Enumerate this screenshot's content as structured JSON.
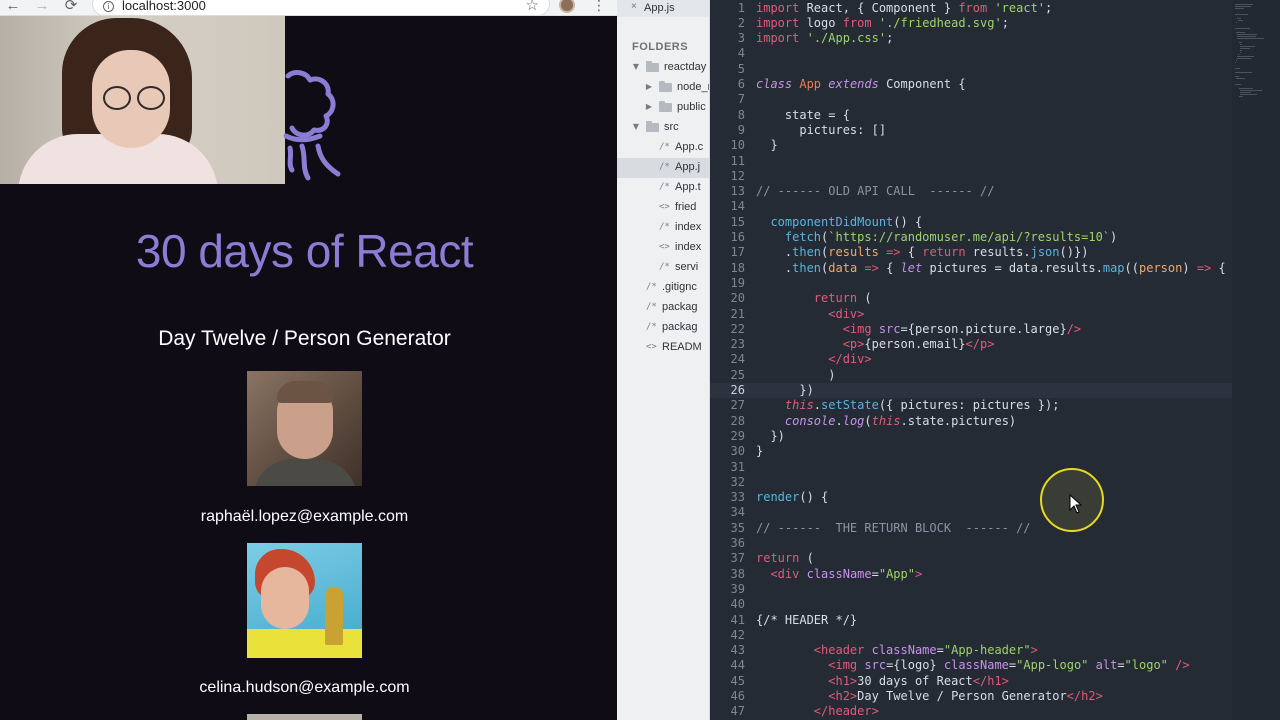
{
  "browser": {
    "url": "localhost:3000",
    "nav": {
      "back": "←",
      "forward": "→",
      "reload": "⟳"
    },
    "star": "☆",
    "info": "i",
    "menu": "⋮"
  },
  "app": {
    "title": "30 days of React",
    "subtitle": "Day Twelve / Person Generator",
    "people": [
      {
        "email": "raphaël.lopez@example.com"
      },
      {
        "email": "celina.hudson@example.com"
      }
    ]
  },
  "editor": {
    "tab": {
      "label": "App.js",
      "close": "×"
    },
    "folders_heading": "FOLDERS",
    "tree": [
      {
        "label": "reactday",
        "arrow": "▼",
        "kind": "folder"
      },
      {
        "label": "node_m",
        "arrow": "▶",
        "kind": "folder"
      },
      {
        "label": "public",
        "arrow": "▶",
        "kind": "folder"
      },
      {
        "label": "src",
        "arrow": "▼",
        "kind": "folder"
      },
      {
        "label": "App.c",
        "icon": "/*",
        "kind": "file"
      },
      {
        "label": "App.j",
        "icon": "/*",
        "kind": "file",
        "selected": true
      },
      {
        "label": "App.t",
        "icon": "/*",
        "kind": "file"
      },
      {
        "label": "fried",
        "icon": "<>",
        "kind": "file"
      },
      {
        "label": "index",
        "icon": "/*",
        "kind": "file"
      },
      {
        "label": "index",
        "icon": "<>",
        "kind": "file"
      },
      {
        "label": "servi",
        "icon": "/*",
        "kind": "file"
      },
      {
        "label": ".gitignc",
        "icon": "/*",
        "kind": "file"
      },
      {
        "label": "packag",
        "icon": "/*",
        "kind": "file"
      },
      {
        "label": "packag",
        "icon": "/*",
        "kind": "file"
      },
      {
        "label": "READM",
        "icon": "<>",
        "kind": "file"
      }
    ],
    "current_line": 26,
    "code": [
      [
        [
          "k",
          "import"
        ],
        [
          "pn",
          " React, { Component } "
        ],
        [
          "k",
          "from"
        ],
        [
          "pn",
          " "
        ],
        [
          "s",
          "'react'"
        ],
        [
          "pn",
          ";"
        ]
      ],
      [
        [
          "k",
          "import"
        ],
        [
          "pn",
          " logo "
        ],
        [
          "k",
          "from"
        ],
        [
          "pn",
          " "
        ],
        [
          "s",
          "'./friedhead.svg'"
        ],
        [
          "pn",
          ";"
        ]
      ],
      [
        [
          "k",
          "import"
        ],
        [
          "pn",
          " "
        ],
        [
          "s",
          "'./App.css'"
        ],
        [
          "pn",
          ";"
        ]
      ],
      [],
      [],
      [
        [
          "it",
          "class"
        ],
        [
          "pn",
          " "
        ],
        [
          "cls",
          "App"
        ],
        [
          "pn",
          " "
        ],
        [
          "it",
          "extends"
        ],
        [
          "pn",
          " Component {"
        ]
      ],
      [],
      [
        [
          "pn",
          "    state = {"
        ]
      ],
      [
        [
          "pn",
          "      pictures: []"
        ]
      ],
      [
        [
          "pn",
          "  }"
        ]
      ],
      [],
      [],
      [
        [
          "c",
          "// ------ OLD API CALL  ------ //"
        ]
      ],
      [],
      [
        [
          "f",
          "  componentDidMount"
        ],
        [
          "pn",
          "() {"
        ]
      ],
      [
        [
          "f",
          "    fetch"
        ],
        [
          "pn",
          "("
        ],
        [
          "s",
          "`https://randomuser.me/api/?results=10`"
        ],
        [
          "pn",
          ")"
        ]
      ],
      [
        [
          "pn",
          "    ."
        ],
        [
          "f",
          "then"
        ],
        [
          "pn",
          "("
        ],
        [
          "pm",
          "results"
        ],
        [
          "pn",
          " "
        ],
        [
          "k",
          "=>"
        ],
        [
          "pn",
          " { "
        ],
        [
          "k",
          "return"
        ],
        [
          "pn",
          " results."
        ],
        [
          "f",
          "json"
        ],
        [
          "pn",
          "()})"
        ]
      ],
      [
        [
          "pn",
          "    ."
        ],
        [
          "f",
          "then"
        ],
        [
          "pn",
          "("
        ],
        [
          "pm",
          "data"
        ],
        [
          "pn",
          " "
        ],
        [
          "k",
          "=>"
        ],
        [
          "pn",
          " { "
        ],
        [
          "it",
          "let"
        ],
        [
          "pn",
          " pictures = data.results."
        ],
        [
          "f",
          "map"
        ],
        [
          "pn",
          "(("
        ],
        [
          "pm",
          "person"
        ],
        [
          "pn",
          ") "
        ],
        [
          "k",
          "=>"
        ],
        [
          "pn",
          " {"
        ]
      ],
      [],
      [
        [
          "k",
          "        return"
        ],
        [
          "pn",
          " ("
        ]
      ],
      [
        [
          "tg",
          "          <div"
        ],
        [
          "tg",
          ">"
        ]
      ],
      [
        [
          "tg",
          "            <img"
        ],
        [
          "pn",
          " "
        ],
        [
          "at",
          "src"
        ],
        [
          "pn",
          "={person.picture.large}"
        ],
        [
          "tg",
          "/>"
        ]
      ],
      [
        [
          "tg",
          "            <p"
        ],
        [
          "tg",
          ">"
        ],
        [
          "pn",
          "{person.email}"
        ],
        [
          "tg",
          "</p>"
        ]
      ],
      [
        [
          "tg",
          "          </div>"
        ]
      ],
      [
        [
          "pn",
          "          )"
        ]
      ],
      [
        [
          "pn",
          "      })"
        ]
      ],
      [
        [
          "th",
          "    this"
        ],
        [
          "pn",
          "."
        ],
        [
          "f",
          "setState"
        ],
        [
          "pn",
          "({ pictures: pictures });"
        ]
      ],
      [
        [
          "it",
          "    console"
        ],
        [
          "pn",
          "."
        ],
        [
          "it",
          "log"
        ],
        [
          "pn",
          "("
        ],
        [
          "th",
          "this"
        ],
        [
          "pn",
          ".state.pictures)"
        ]
      ],
      [
        [
          "pn",
          "  })"
        ]
      ],
      [
        [
          "pn",
          "}"
        ]
      ],
      [],
      [],
      [
        [
          "f",
          "render"
        ],
        [
          "pn",
          "() {"
        ]
      ],
      [],
      [
        [
          "c",
          "// ------  THE RETURN BLOCK  ------ //"
        ]
      ],
      [],
      [
        [
          "k",
          "return"
        ],
        [
          "pn",
          " ("
        ]
      ],
      [
        [
          "tg",
          "  <div"
        ],
        [
          "pn",
          " "
        ],
        [
          "at",
          "className"
        ],
        [
          "pn",
          "="
        ],
        [
          "s",
          "\"App\""
        ],
        [
          "tg",
          ">"
        ]
      ],
      [],
      [],
      [
        [
          "pn",
          "{/* HEADER */}"
        ]
      ],
      [],
      [
        [
          "tg",
          "        <header"
        ],
        [
          "pn",
          " "
        ],
        [
          "at",
          "className"
        ],
        [
          "pn",
          "="
        ],
        [
          "s",
          "\"App-header\""
        ],
        [
          "tg",
          ">"
        ]
      ],
      [
        [
          "tg",
          "          <img"
        ],
        [
          "pn",
          " "
        ],
        [
          "at",
          "src"
        ],
        [
          "pn",
          "={logo} "
        ],
        [
          "at",
          "className"
        ],
        [
          "pn",
          "="
        ],
        [
          "s",
          "\"App-logo\""
        ],
        [
          "pn",
          " "
        ],
        [
          "at",
          "alt"
        ],
        [
          "pn",
          "="
        ],
        [
          "s",
          "\"logo\""
        ],
        [
          "pn",
          " "
        ],
        [
          "tg",
          "/>"
        ]
      ],
      [
        [
          "tg",
          "          <h1"
        ],
        [
          "tg",
          ">"
        ],
        [
          "pn",
          "30 days of React"
        ],
        [
          "tg",
          "</h1>"
        ]
      ],
      [
        [
          "tg",
          "          <h2"
        ],
        [
          "tg",
          ">"
        ],
        [
          "pn",
          "Day Twelve / Person Generator"
        ],
        [
          "tg",
          "</h2>"
        ]
      ],
      [
        [
          "tg",
          "        </header>"
        ]
      ]
    ]
  },
  "colors": {
    "accent_title": "#8b7dd3",
    "editor_bg": "#252b35",
    "cursor_ring": "#e8da1c"
  },
  "icons": [
    "back-icon",
    "forward-icon",
    "reload-icon",
    "info-icon",
    "star-icon",
    "profile-icon",
    "menu-icon",
    "close-icon",
    "folder-icon",
    "file-icon",
    "mouse-pointer-icon"
  ]
}
